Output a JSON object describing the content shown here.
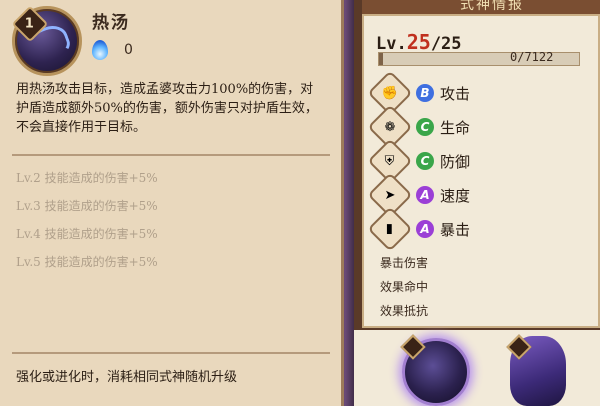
{
  "skill": {
    "level_badge": "1",
    "name": "热汤",
    "onibi_cost": "0",
    "description": "用热汤攻击目标，造成孟婆攻击力100%的伤害，对护盾造成额外50%的伤害，额外伤害只对护盾生效，不会直接作用于目标。",
    "upgrades": [
      "Lv.2  技能造成的伤害+5%",
      "Lv.3  技能造成的伤害+5%",
      "Lv.4  技能造成的伤害+5%",
      "Lv.5  技能造成的伤害+5%"
    ],
    "upgrade_note": "强化或进化时，消耗相同式神随机升级"
  },
  "info": {
    "title": "式神情报",
    "level_prefix": "Lv.",
    "level_current": "25",
    "level_max": "/25",
    "exp_text": "0/7122",
    "exp_fraction": 0.02,
    "stats": [
      {
        "icon": "attack-fist-icon",
        "grade": "B",
        "grade_color": "#3f6fe0",
        "name": "攻击"
      },
      {
        "icon": "health-scroll-icon",
        "grade": "C",
        "grade_color": "#3aa64a",
        "name": "生命"
      },
      {
        "icon": "defense-armor-icon",
        "grade": "C",
        "grade_color": "#3aa64a",
        "name": "防御"
      },
      {
        "icon": "speed-boot-icon",
        "grade": "A",
        "grade_color": "#9b3fd6",
        "name": "速度"
      },
      {
        "icon": "crit-card-icon",
        "grade": "A",
        "grade_color": "#9b3fd6",
        "name": "暴击"
      }
    ],
    "sub_stats": [
      "暴击伤害",
      "效果命中",
      "效果抵抗"
    ]
  }
}
